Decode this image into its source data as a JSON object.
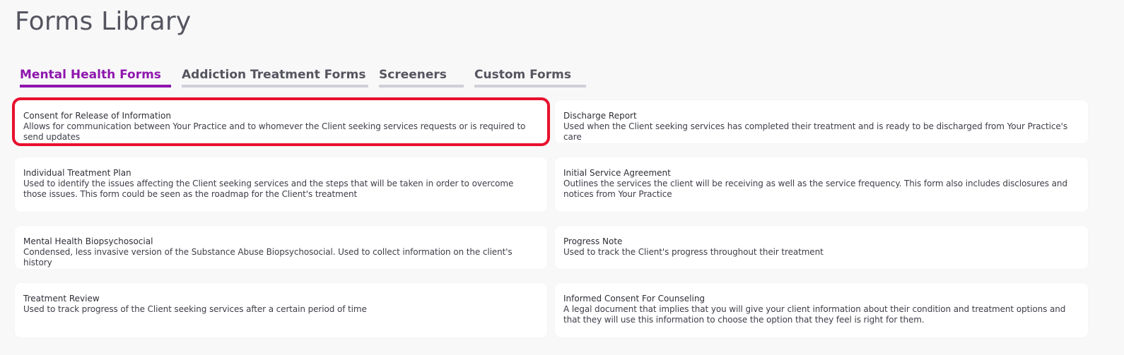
{
  "page": {
    "title": "Forms Library"
  },
  "tabs": [
    {
      "label": "Mental Health Forms",
      "active": true
    },
    {
      "label": "Addiction Treatment Forms",
      "active": false
    },
    {
      "label": "Screeners",
      "active": false
    },
    {
      "label": "Custom Forms",
      "active": false
    }
  ],
  "forms": [
    {
      "title": "Consent for Release of Information",
      "description": "Allows for communication between Your Practice and to whomever the Client seeking services requests or is required to send updates"
    },
    {
      "title": "Discharge Report",
      "description": "Used when the Client seeking services has completed their treatment and is ready to be discharged from Your Practice's care"
    },
    {
      "title": "Individual Treatment Plan",
      "description": "Used to identify the issues affecting the Client seeking services and the steps that will be taken in order to overcome those issues. This form could be seen as the roadmap for the Client's treatment"
    },
    {
      "title": "Initial Service Agreement",
      "description": "Outlines the services the client will be receiving as well as the service frequency. This form also includes disclosures and notices from Your Practice"
    },
    {
      "title": "Mental Health Biopsychosocial",
      "description": "Condensed, less invasive version of the Substance Abuse Biopsychosocial. Used to collect information on the client's history"
    },
    {
      "title": "Progress Note",
      "description": "Used to track the Client's progress throughout their treatment"
    },
    {
      "title": "Treatment Review",
      "description": "Used to track progress of the Client seeking services after a certain period of time"
    },
    {
      "title": "Informed Consent For Counseling",
      "description": "A legal document that implies that you will give your client information about their condition and treatment options and that they will use this information to choose the option that they feel is right for them."
    }
  ],
  "colors": {
    "accent": "#8e16ad",
    "highlight": "#e8102e",
    "background": "#f8f8f9"
  }
}
